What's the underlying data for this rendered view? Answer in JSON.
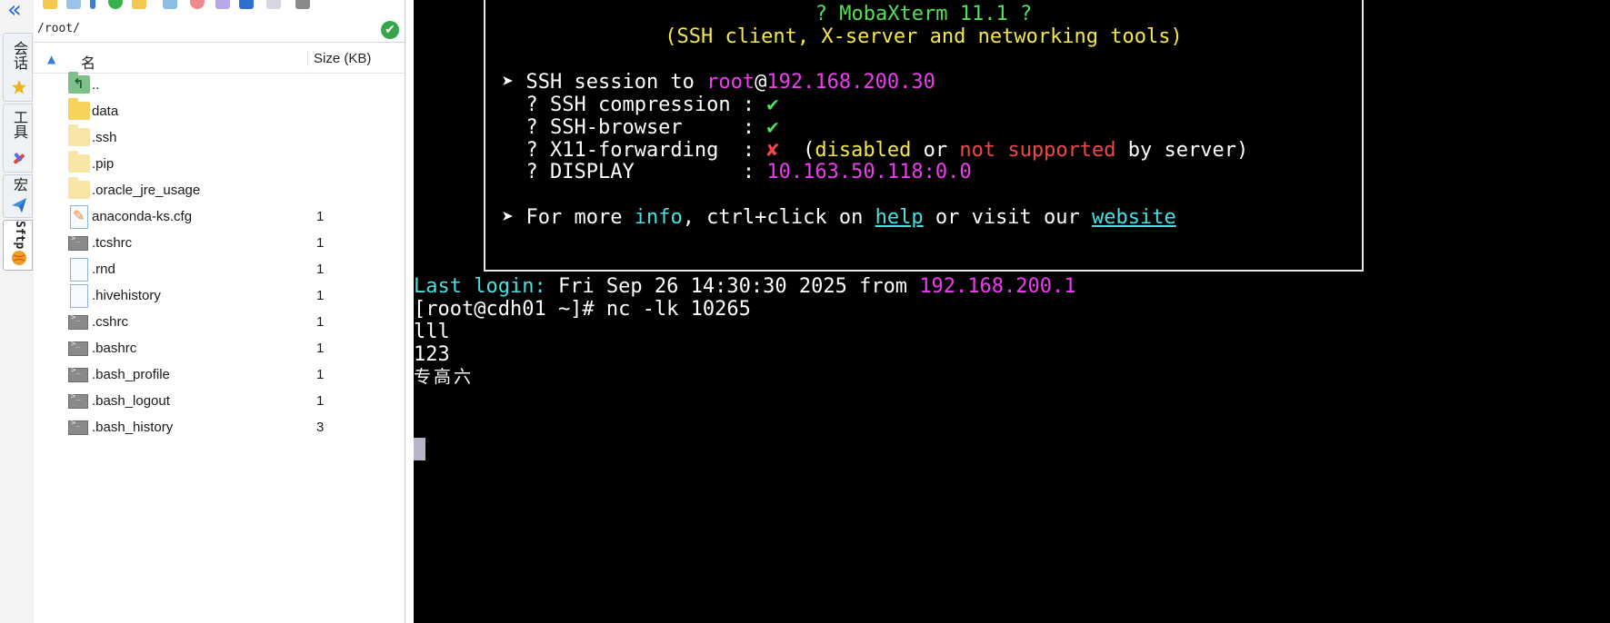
{
  "sidebar": {
    "tabs": [
      {
        "label": "会话",
        "icon": "star-icon"
      },
      {
        "label": "工具",
        "icon": "tools-icon"
      },
      {
        "label": "宏",
        "icon": "paper-plane-icon"
      },
      {
        "label": "Sftp",
        "icon": "globe-icon"
      }
    ],
    "collapse_icon": "double-chevron-left-icon"
  },
  "browser": {
    "path": "/root/",
    "columns": {
      "name": "名",
      "size": "Size (KB)"
    },
    "files": [
      {
        "name": "..",
        "size": "",
        "icon": "folder-up-icon"
      },
      {
        "name": "data",
        "size": "",
        "icon": "folder-icon"
      },
      {
        "name": ".ssh",
        "size": "",
        "icon": "folder-icon"
      },
      {
        "name": ".pip",
        "size": "",
        "icon": "folder-icon"
      },
      {
        "name": ".oracle_jre_usage",
        "size": "",
        "icon": "folder-icon"
      },
      {
        "name": "anaconda-ks.cfg",
        "size": "1",
        "icon": "edit-file-icon"
      },
      {
        "name": ".tcshrc",
        "size": "1",
        "icon": "terminal-file-icon"
      },
      {
        "name": ".rnd",
        "size": "1",
        "icon": "file-icon"
      },
      {
        "name": ".hivehistory",
        "size": "1",
        "icon": "file-icon"
      },
      {
        "name": ".cshrc",
        "size": "1",
        "icon": "terminal-file-icon"
      },
      {
        "name": ".bashrc",
        "size": "1",
        "icon": "terminal-file-icon"
      },
      {
        "name": ".bash_profile",
        "size": "1",
        "icon": "terminal-file-icon"
      },
      {
        "name": ".bash_logout",
        "size": "1",
        "icon": "terminal-file-icon"
      },
      {
        "name": ".bash_history",
        "size": "3",
        "icon": "terminal-file-icon"
      }
    ]
  },
  "terminal": {
    "banner": {
      "title": "? MobaXterm 11.1 ?",
      "subtitle": "(SSH client, X-server and networking tools)",
      "session_prefix": "➤ SSH session to ",
      "session_user": "root",
      "session_at": "@",
      "session_host": "192.168.200.30",
      "compression_label": "  ? SSH compression : ",
      "compression_value": "✔",
      "browser_label": "  ? SSH-browser     : ",
      "browser_value": "✔",
      "x11_label": "  ? X11-forwarding  : ",
      "x11_value": "✘",
      "x11_open": "  (",
      "x11_disabled": "disabled",
      "x11_or": " or ",
      "x11_not_supported": "not supported",
      "x11_close": " by server)",
      "display_label": "  ? DISPLAY         : ",
      "display_value": "10.163.50.118:0.0",
      "more_prefix": "➤ For more ",
      "more_info": "info",
      "more_mid": ", ctrl+click on ",
      "more_help": "help",
      "more_visit": " or visit our ",
      "more_website": "website"
    },
    "last_login_label": "Last login:",
    "last_login_text": " Fri Sep 26 14:30:30 2025 from ",
    "last_login_host": "192.168.200.1",
    "lines": [
      "[root@cdh01 ~]# nc -lk 10265",
      "lll",
      "123",
      "专高六"
    ]
  },
  "colors": {
    "accent": "#3b7ed6",
    "terminal_bg": "#000000",
    "green": "#55e055",
    "yellow": "#f5e84a",
    "magenta": "#f03cf0",
    "red": "#f04848",
    "cyan": "#48e0e0"
  }
}
